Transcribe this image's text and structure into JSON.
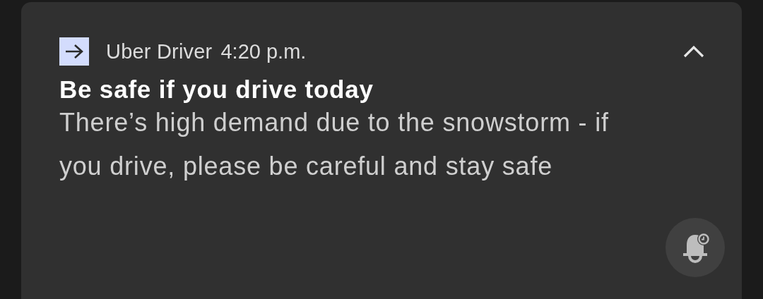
{
  "notification": {
    "app_name": "Uber Driver",
    "time": "4:20 p.m.",
    "expanded": true,
    "title": "Be safe if you drive today",
    "body": "There’s high demand due to the snowstorm - if you drive, please be careful and stay safe"
  }
}
